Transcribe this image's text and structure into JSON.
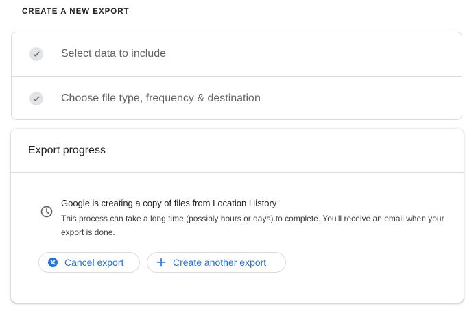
{
  "section_heading": "CREATE A NEW EXPORT",
  "steps": [
    {
      "label": "Select data to include",
      "icon": "check-icon",
      "status": "complete"
    },
    {
      "label": "Choose file type, frequency & destination",
      "icon": "check-icon",
      "status": "complete"
    }
  ],
  "progress": {
    "title": "Export progress",
    "status_icon": "clock-icon",
    "status_title": "Google is creating a copy of files from Location History",
    "status_description": "This process can take a long time (possibly hours or days) to complete. You'll receive an email when your export is done.",
    "buttons": {
      "cancel_label": "Cancel export",
      "cancel_icon": "cancel-circle-icon",
      "create_label": "Create another export",
      "create_icon": "plus-icon"
    }
  },
  "colors": {
    "accent": "#1a73e8",
    "border": "#dadce0",
    "muted_text": "#5f6368"
  }
}
